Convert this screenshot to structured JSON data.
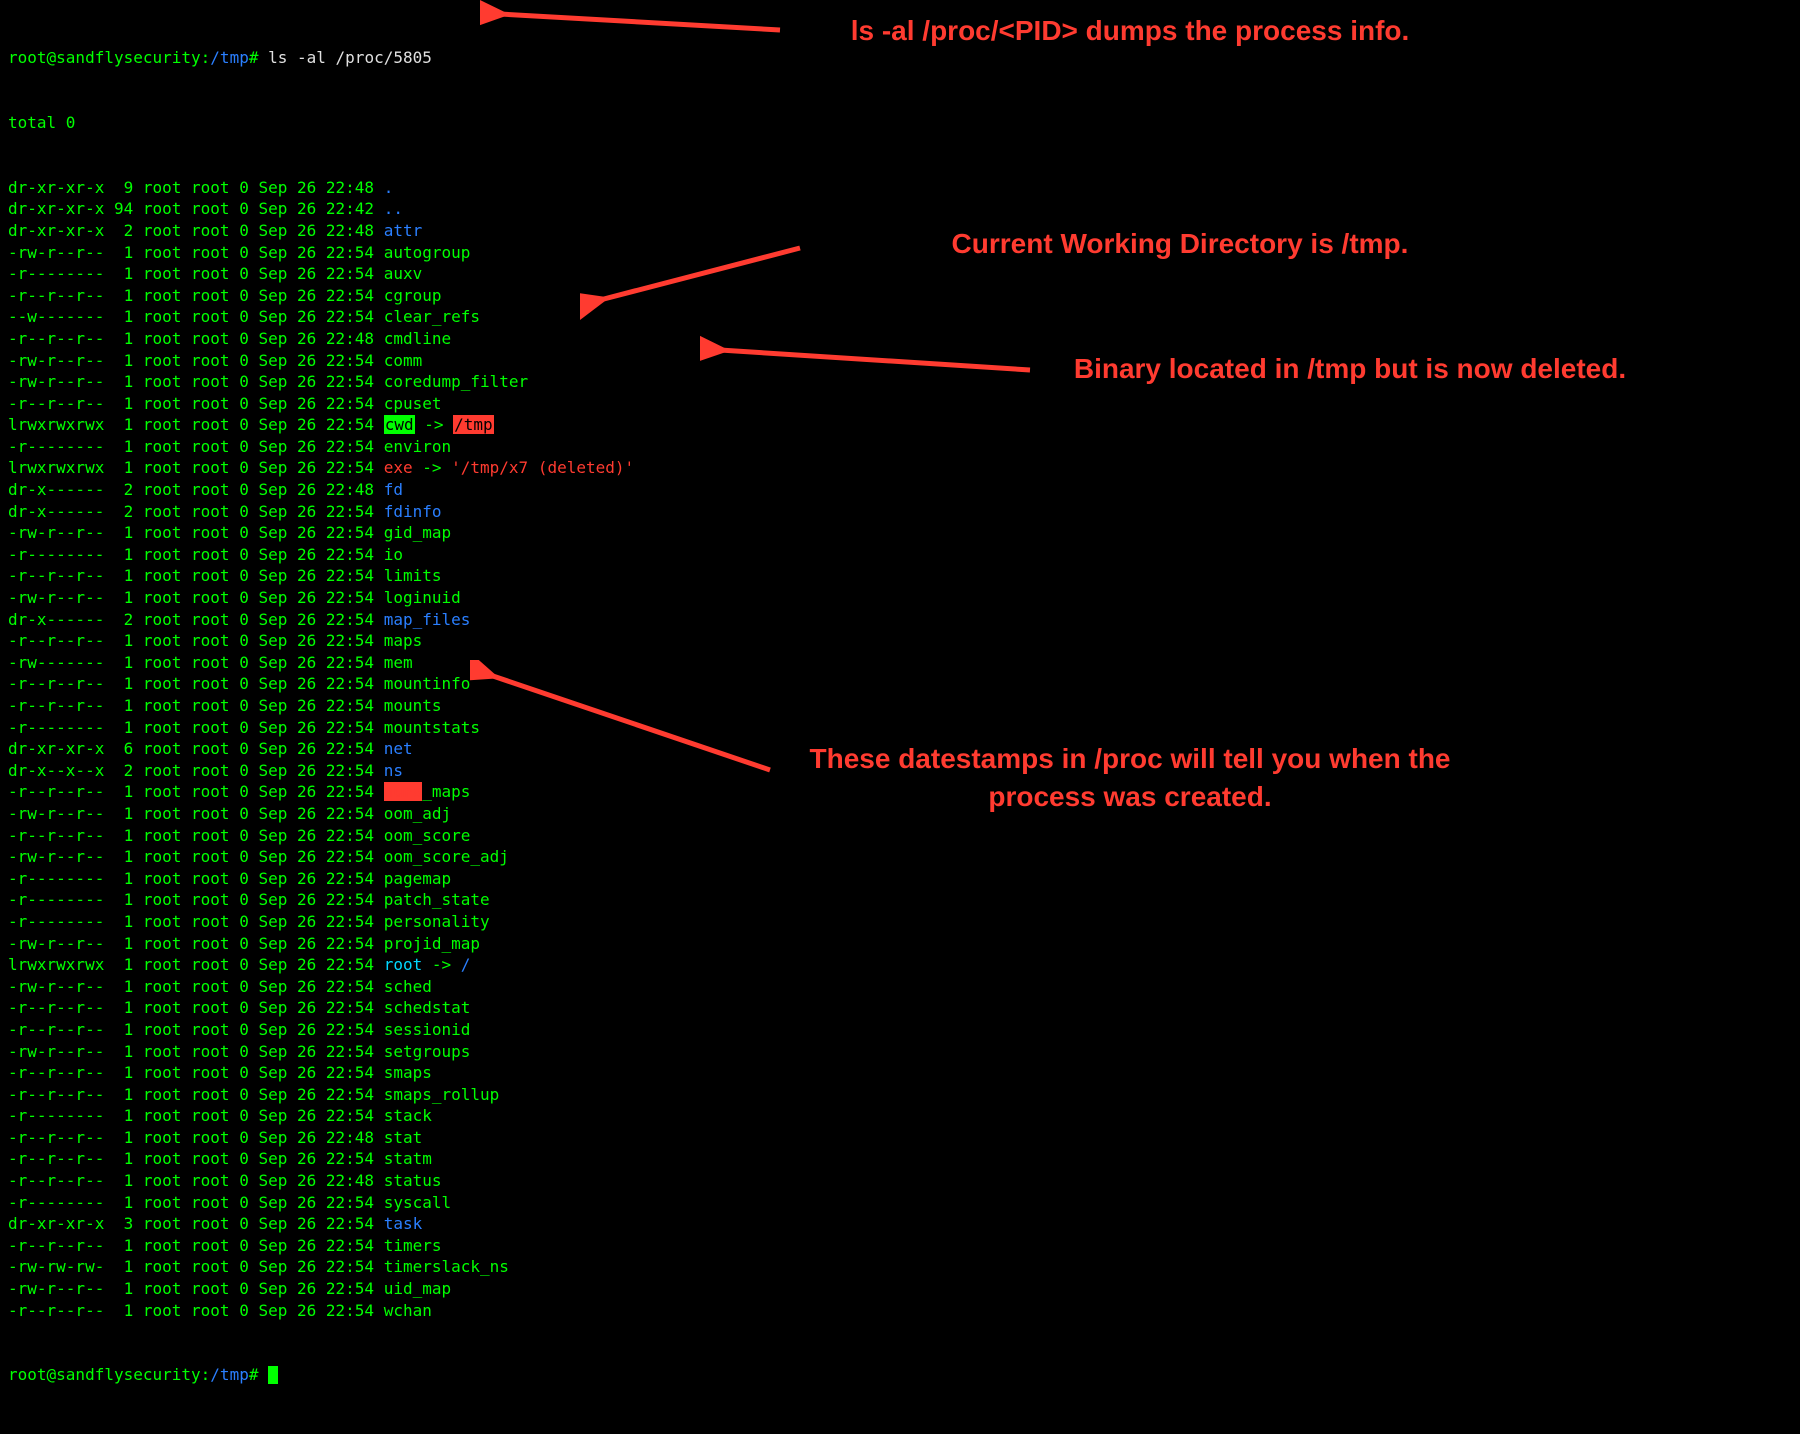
{
  "prompt": {
    "user_host": "root@sandflysecurity",
    "sep": ":",
    "cwd": "/tmp",
    "hash": "#",
    "command": "ls -al /proc/5805"
  },
  "total_line": "total 0",
  "rows": [
    {
      "perm": "dr-xr-xr-x",
      "links": "9",
      "own": "root root",
      "size": "0",
      "date": "Sep 26 22:48",
      "name": ".",
      "cls": "blue"
    },
    {
      "perm": "dr-xr-xr-x",
      "links": "94",
      "own": "root root",
      "size": "0",
      "date": "Sep 26 22:42",
      "name": "..",
      "cls": "blue"
    },
    {
      "perm": "dr-xr-xr-x",
      "links": "2",
      "own": "root root",
      "size": "0",
      "date": "Sep 26 22:48",
      "name": "attr",
      "cls": "blue"
    },
    {
      "perm": "-rw-r--r--",
      "links": "1",
      "own": "root root",
      "size": "0",
      "date": "Sep 26 22:54",
      "name": "autogroup",
      "cls": "green"
    },
    {
      "perm": "-r--------",
      "links": "1",
      "own": "root root",
      "size": "0",
      "date": "Sep 26 22:54",
      "name": "auxv",
      "cls": "green"
    },
    {
      "perm": "-r--r--r--",
      "links": "1",
      "own": "root root",
      "size": "0",
      "date": "Sep 26 22:54",
      "name": "cgroup",
      "cls": "green"
    },
    {
      "perm": "--w-------",
      "links": "1",
      "own": "root root",
      "size": "0",
      "date": "Sep 26 22:54",
      "name": "clear_refs",
      "cls": "green"
    },
    {
      "perm": "-r--r--r--",
      "links": "1",
      "own": "root root",
      "size": "0",
      "date": "Sep 26 22:48",
      "name": "cmdline",
      "cls": "green"
    },
    {
      "perm": "-rw-r--r--",
      "links": "1",
      "own": "root root",
      "size": "0",
      "date": "Sep 26 22:54",
      "name": "comm",
      "cls": "green"
    },
    {
      "perm": "-rw-r--r--",
      "links": "1",
      "own": "root root",
      "size": "0",
      "date": "Sep 26 22:54",
      "name": "coredump_filter",
      "cls": "green"
    },
    {
      "perm": "-r--r--r--",
      "links": "1",
      "own": "root root",
      "size": "0",
      "date": "Sep 26 22:54",
      "name": "cpuset",
      "cls": "green"
    },
    {
      "perm": "lrwxrwxrwx",
      "links": "1",
      "own": "root root",
      "size": "0",
      "date": "Sep 26 22:54",
      "special": "cwd"
    },
    {
      "perm": "-r--------",
      "links": "1",
      "own": "root root",
      "size": "0",
      "date": "Sep 26 22:54",
      "name": "environ",
      "cls": "green"
    },
    {
      "perm": "lrwxrwxrwx",
      "links": "1",
      "own": "root root",
      "size": "0",
      "date": "Sep 26 22:54",
      "special": "exe"
    },
    {
      "perm": "dr-x------",
      "links": "2",
      "own": "root root",
      "size": "0",
      "date": "Sep 26 22:48",
      "name": "fd",
      "cls": "blue"
    },
    {
      "perm": "dr-x------",
      "links": "2",
      "own": "root root",
      "size": "0",
      "date": "Sep 26 22:54",
      "name": "fdinfo",
      "cls": "blue"
    },
    {
      "perm": "-rw-r--r--",
      "links": "1",
      "own": "root root",
      "size": "0",
      "date": "Sep 26 22:54",
      "name": "gid_map",
      "cls": "green"
    },
    {
      "perm": "-r--------",
      "links": "1",
      "own": "root root",
      "size": "0",
      "date": "Sep 26 22:54",
      "name": "io",
      "cls": "green"
    },
    {
      "perm": "-r--r--r--",
      "links": "1",
      "own": "root root",
      "size": "0",
      "date": "Sep 26 22:54",
      "name": "limits",
      "cls": "green"
    },
    {
      "perm": "-rw-r--r--",
      "links": "1",
      "own": "root root",
      "size": "0",
      "date": "Sep 26 22:54",
      "name": "loginuid",
      "cls": "green"
    },
    {
      "perm": "dr-x------",
      "links": "2",
      "own": "root root",
      "size": "0",
      "date": "Sep 26 22:54",
      "name": "map_files",
      "cls": "blue"
    },
    {
      "perm": "-r--r--r--",
      "links": "1",
      "own": "root root",
      "size": "0",
      "date": "Sep 26 22:54",
      "name": "maps",
      "cls": "green"
    },
    {
      "perm": "-rw-------",
      "links": "1",
      "own": "root root",
      "size": "0",
      "date": "Sep 26 22:54",
      "name": "mem",
      "cls": "green"
    },
    {
      "perm": "-r--r--r--",
      "links": "1",
      "own": "root root",
      "size": "0",
      "date": "Sep 26 22:54",
      "name": "mountinfo",
      "cls": "green"
    },
    {
      "perm": "-r--r--r--",
      "links": "1",
      "own": "root root",
      "size": "0",
      "date": "Sep 26 22:54",
      "name": "mounts",
      "cls": "green"
    },
    {
      "perm": "-r--------",
      "links": "1",
      "own": "root root",
      "size": "0",
      "date": "Sep 26 22:54",
      "name": "mountstats",
      "cls": "green"
    },
    {
      "perm": "dr-xr-xr-x",
      "links": "6",
      "own": "root root",
      "size": "0",
      "date": "Sep 26 22:54",
      "name": "net",
      "cls": "blue"
    },
    {
      "perm": "dr-x--x--x",
      "links": "2",
      "own": "root root",
      "size": "0",
      "date": "Sep 26 22:54",
      "name": "ns",
      "cls": "blue"
    },
    {
      "perm": "-r--r--r--",
      "links": "1",
      "own": "root root",
      "size": "0",
      "date": "Sep 26 22:54",
      "special": "numa_maps"
    },
    {
      "perm": "-rw-r--r--",
      "links": "1",
      "own": "root root",
      "size": "0",
      "date": "Sep 26 22:54",
      "name": "oom_adj",
      "cls": "green"
    },
    {
      "perm": "-r--r--r--",
      "links": "1",
      "own": "root root",
      "size": "0",
      "date": "Sep 26 22:54",
      "name": "oom_score",
      "cls": "green"
    },
    {
      "perm": "-rw-r--r--",
      "links": "1",
      "own": "root root",
      "size": "0",
      "date": "Sep 26 22:54",
      "name": "oom_score_adj",
      "cls": "green"
    },
    {
      "perm": "-r--------",
      "links": "1",
      "own": "root root",
      "size": "0",
      "date": "Sep 26 22:54",
      "name": "pagemap",
      "cls": "green"
    },
    {
      "perm": "-r--------",
      "links": "1",
      "own": "root root",
      "size": "0",
      "date": "Sep 26 22:54",
      "name": "patch_state",
      "cls": "green"
    },
    {
      "perm": "-r--------",
      "links": "1",
      "own": "root root",
      "size": "0",
      "date": "Sep 26 22:54",
      "name": "personality",
      "cls": "green"
    },
    {
      "perm": "-rw-r--r--",
      "links": "1",
      "own": "root root",
      "size": "0",
      "date": "Sep 26 22:54",
      "name": "projid_map",
      "cls": "green"
    },
    {
      "perm": "lrwxrwxrwx",
      "links": "1",
      "own": "root root",
      "size": "0",
      "date": "Sep 26 22:54",
      "special": "root"
    },
    {
      "perm": "-rw-r--r--",
      "links": "1",
      "own": "root root",
      "size": "0",
      "date": "Sep 26 22:54",
      "name": "sched",
      "cls": "green"
    },
    {
      "perm": "-r--r--r--",
      "links": "1",
      "own": "root root",
      "size": "0",
      "date": "Sep 26 22:54",
      "name": "schedstat",
      "cls": "green"
    },
    {
      "perm": "-r--r--r--",
      "links": "1",
      "own": "root root",
      "size": "0",
      "date": "Sep 26 22:54",
      "name": "sessionid",
      "cls": "green"
    },
    {
      "perm": "-rw-r--r--",
      "links": "1",
      "own": "root root",
      "size": "0",
      "date": "Sep 26 22:54",
      "name": "setgroups",
      "cls": "green"
    },
    {
      "perm": "-r--r--r--",
      "links": "1",
      "own": "root root",
      "size": "0",
      "date": "Sep 26 22:54",
      "name": "smaps",
      "cls": "green"
    },
    {
      "perm": "-r--r--r--",
      "links": "1",
      "own": "root root",
      "size": "0",
      "date": "Sep 26 22:54",
      "name": "smaps_rollup",
      "cls": "green"
    },
    {
      "perm": "-r--------",
      "links": "1",
      "own": "root root",
      "size": "0",
      "date": "Sep 26 22:54",
      "name": "stack",
      "cls": "green"
    },
    {
      "perm": "-r--r--r--",
      "links": "1",
      "own": "root root",
      "size": "0",
      "date": "Sep 26 22:48",
      "name": "stat",
      "cls": "green"
    },
    {
      "perm": "-r--r--r--",
      "links": "1",
      "own": "root root",
      "size": "0",
      "date": "Sep 26 22:54",
      "name": "statm",
      "cls": "green"
    },
    {
      "perm": "-r--r--r--",
      "links": "1",
      "own": "root root",
      "size": "0",
      "date": "Sep 26 22:48",
      "name": "status",
      "cls": "green"
    },
    {
      "perm": "-r--------",
      "links": "1",
      "own": "root root",
      "size": "0",
      "date": "Sep 26 22:54",
      "name": "syscall",
      "cls": "green"
    },
    {
      "perm": "dr-xr-xr-x",
      "links": "3",
      "own": "root root",
      "size": "0",
      "date": "Sep 26 22:54",
      "name": "task",
      "cls": "blue"
    },
    {
      "perm": "-r--r--r--",
      "links": "1",
      "own": "root root",
      "size": "0",
      "date": "Sep 26 22:54",
      "name": "timers",
      "cls": "green"
    },
    {
      "perm": "-rw-rw-rw-",
      "links": "1",
      "own": "root root",
      "size": "0",
      "date": "Sep 26 22:54",
      "name": "timerslack_ns",
      "cls": "green"
    },
    {
      "perm": "-rw-r--r--",
      "links": "1",
      "own": "root root",
      "size": "0",
      "date": "Sep 26 22:54",
      "name": "uid_map",
      "cls": "green"
    },
    {
      "perm": "-r--r--r--",
      "links": "1",
      "own": "root root",
      "size": "0",
      "date": "Sep 26 22:54",
      "name": "wchan",
      "cls": "green"
    }
  ],
  "cwd_link": {
    "name": "cwd",
    "arrow": " -> ",
    "target": "/tmp"
  },
  "exe_link": {
    "name": "exe",
    "arrow": " -> ",
    "target": "'/tmp/x7 (deleted)'"
  },
  "root_link": {
    "name": "root",
    "arrow": " -> ",
    "target": "/"
  },
  "numa_maps_covered": {
    "name": "numa_maps"
  },
  "annotations": {
    "a1": "ls -al /proc/<PID> dumps the process info.",
    "a2": "Current Working Directory is /tmp.",
    "a3": "Binary located in /tmp but is now deleted.",
    "a4": "These datestamps in /proc will tell you when the process was created."
  }
}
